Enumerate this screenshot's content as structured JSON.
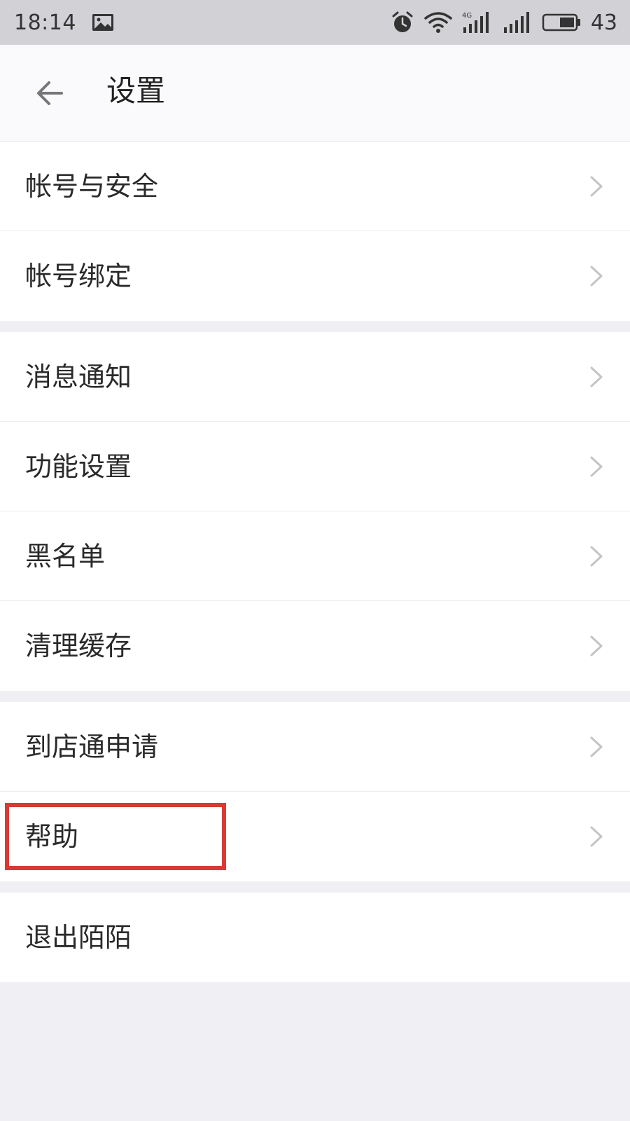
{
  "status_bar": {
    "time": "18:14",
    "battery": "43",
    "icons": [
      "gallery-icon",
      "alarm-icon",
      "wifi-icon",
      "signal-4g-icon",
      "signal-icon",
      "battery-icon"
    ]
  },
  "header": {
    "back_icon": "back-arrow-icon",
    "title": "设置"
  },
  "groups": [
    {
      "items": [
        {
          "label": "帐号与安全",
          "has_chevron": true
        },
        {
          "label": "帐号绑定",
          "has_chevron": true
        }
      ]
    },
    {
      "items": [
        {
          "label": "消息通知",
          "has_chevron": true
        },
        {
          "label": "功能设置",
          "has_chevron": true
        },
        {
          "label": "黑名单",
          "has_chevron": true
        },
        {
          "label": "清理缓存",
          "has_chevron": true
        }
      ]
    },
    {
      "items": [
        {
          "label": "到店通申请",
          "has_chevron": true
        },
        {
          "label": "帮助",
          "has_chevron": true,
          "highlighted": true
        }
      ]
    },
    {
      "items": [
        {
          "label": "退出陌陌",
          "has_chevron": false
        }
      ]
    }
  ],
  "colors": {
    "highlight": "#d93a36",
    "background": "#efeff4",
    "status_bar": "#d2d2d6",
    "chevron": "#c4c4c8"
  }
}
